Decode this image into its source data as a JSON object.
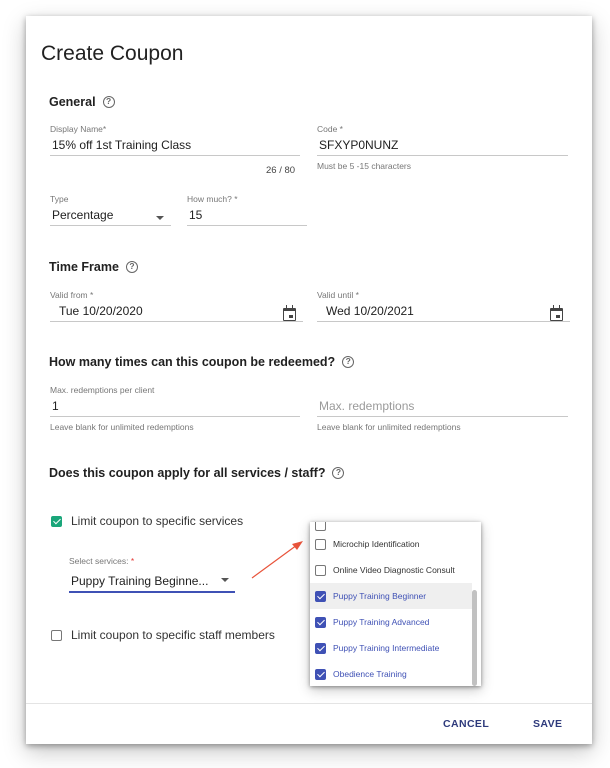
{
  "dialog": {
    "title": "Create Coupon"
  },
  "general": {
    "heading": "General",
    "display_name": {
      "label": "Display Name*",
      "value": "15% off 1st Training Class",
      "counter": "26 / 80"
    },
    "code": {
      "label": "Code *",
      "value": "SFXYP0NUNZ",
      "hint": "Must be 5 -15 characters"
    },
    "type": {
      "label": "Type",
      "value": "Percentage"
    },
    "how_much": {
      "label": "How much? *",
      "value": "15"
    }
  },
  "time_frame": {
    "heading": "Time Frame",
    "valid_from": {
      "label": "Valid from *",
      "value": "Tue 10/20/2020"
    },
    "valid_until": {
      "label": "Valid until *",
      "value": "Wed 10/20/2021"
    }
  },
  "redemptions": {
    "heading": "How many times can this coupon be redeemed?",
    "per_client": {
      "label": "Max. redemptions per client",
      "value": "1",
      "hint": "Leave blank for unlimited redemptions"
    },
    "max": {
      "placeholder": "Max. redemptions",
      "hint": "Leave blank for unlimited redemptions"
    }
  },
  "applies": {
    "heading": "Does this coupon apply for all services / staff?",
    "limit_services": {
      "label": "Limit coupon to specific services",
      "checked": true
    },
    "select_services": {
      "label": "Select services:",
      "required_mark": "*",
      "value": "Puppy Training Beginne..."
    },
    "limit_staff": {
      "label": "Limit coupon to specific staff members",
      "checked": false
    }
  },
  "dropdown": {
    "items": [
      {
        "label": "Microchip Identification",
        "checked": false
      },
      {
        "label": "Online Video Diagnostic Consult",
        "checked": false
      },
      {
        "label": "Puppy Training Beginner",
        "checked": true
      },
      {
        "label": "Puppy Training Advanced",
        "checked": true
      },
      {
        "label": "Puppy Training Intermediate",
        "checked": true
      },
      {
        "label": "Obedience Training",
        "checked": true
      }
    ]
  },
  "footer": {
    "cancel_label": "CANCEL",
    "save_label": "SAVE"
  },
  "colors": {
    "primary": "#3f51b5",
    "check_green": "#1aa67a",
    "annotation_arrow": "#e8533a"
  },
  "icons": [
    "help-icon",
    "calendar-icon",
    "caret-down-icon",
    "checkbox-icon"
  ]
}
